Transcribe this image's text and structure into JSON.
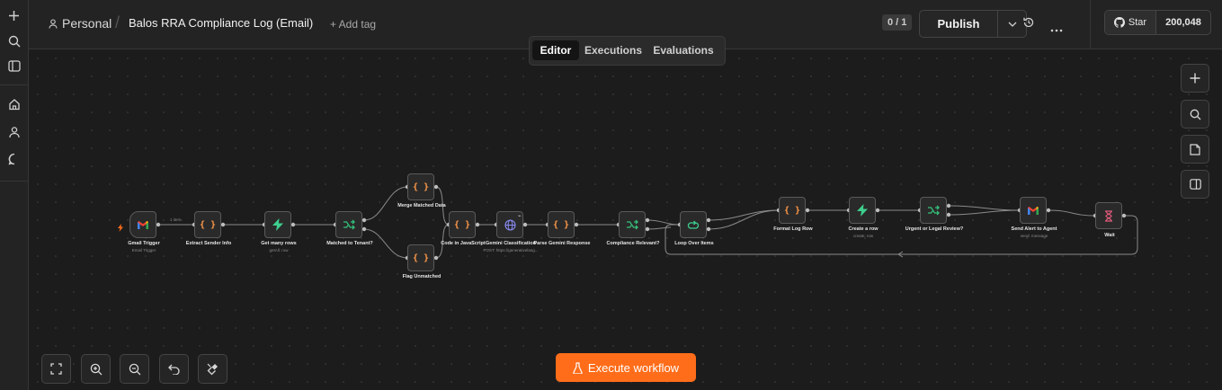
{
  "sidebar": {
    "items": [
      {
        "icon": "plus-icon",
        "name": "sidebar-add"
      },
      {
        "icon": "search-icon",
        "name": "sidebar-search"
      },
      {
        "icon": "panel-icon",
        "name": "sidebar-toggle"
      },
      {
        "icon": "home-icon",
        "name": "sidebar-home"
      },
      {
        "icon": "user-icon",
        "name": "sidebar-user"
      },
      {
        "icon": "chat-icon",
        "name": "sidebar-chat"
      }
    ]
  },
  "header": {
    "project": "Personal",
    "separator": "/",
    "title": "Balos RRA Compliance Log (Email)",
    "add_tag": "+ Add tag",
    "counter": "0 / 1",
    "publish_label": "Publish",
    "github_star": "Star",
    "github_count": "200,048"
  },
  "tabs": [
    {
      "label": "Editor",
      "active": true
    },
    {
      "label": "Executions",
      "active": false
    },
    {
      "label": "Evaluations",
      "active": false
    }
  ],
  "nodes": [
    {
      "id": "gmail",
      "label": "Gmail Trigger",
      "sub": "Email Trigger",
      "icon": "gmail-icon",
      "trigger": true
    },
    {
      "id": "extract",
      "label": "Extract Sender Info",
      "sub": "",
      "icon": "code-icon"
    },
    {
      "id": "getrows",
      "label": "Get many rows",
      "sub": "getAll: row",
      "icon": "bolt-icon"
    },
    {
      "id": "matched",
      "label": "Matched to Tenant?",
      "sub": "",
      "icon": "switch-icon"
    },
    {
      "id": "merge",
      "label": "Merge Matched Data",
      "sub": "",
      "icon": "code-icon"
    },
    {
      "id": "flag",
      "label": "Flag Unmatched",
      "sub": "",
      "icon": "code-icon"
    },
    {
      "id": "codejs",
      "label": "Code in JavaScript",
      "sub": "",
      "icon": "code-icon"
    },
    {
      "id": "gemini",
      "label": "Gemini Classification",
      "sub": "POST: https://generativelang...",
      "icon": "globe-icon"
    },
    {
      "id": "parse",
      "label": "Parse Gemini Response",
      "sub": "",
      "icon": "code-icon"
    },
    {
      "id": "compliance",
      "label": "Compliance Relevant?",
      "sub": "",
      "icon": "switch-icon"
    },
    {
      "id": "loop",
      "label": "Loop Over Items",
      "sub": "",
      "icon": "loop-icon"
    },
    {
      "id": "format",
      "label": "Format Log Row",
      "sub": "",
      "icon": "code-icon"
    },
    {
      "id": "createrow",
      "label": "Create a row",
      "sub": "create: row",
      "icon": "bolt-icon"
    },
    {
      "id": "urgent",
      "label": "Urgent or Legal Review?",
      "sub": "",
      "icon": "switch-icon"
    },
    {
      "id": "sendalert",
      "label": "Send Alert to Agent",
      "sub": "send: message",
      "icon": "gmail-icon"
    },
    {
      "id": "wait",
      "label": "Wait",
      "sub": "",
      "icon": "hourglass-icon"
    }
  ],
  "edge_labels": {
    "gmail_to_extract": "1 item"
  },
  "execute_label": "Execute workflow",
  "colors": {
    "accent": "#ff6d1a",
    "code": "#ff9a4a",
    "bolt": "#3ecf8e",
    "switch": "#35c07a",
    "globe": "#8a8cf6",
    "loop": "#3ecf8e",
    "wait": "#e05a7a"
  }
}
